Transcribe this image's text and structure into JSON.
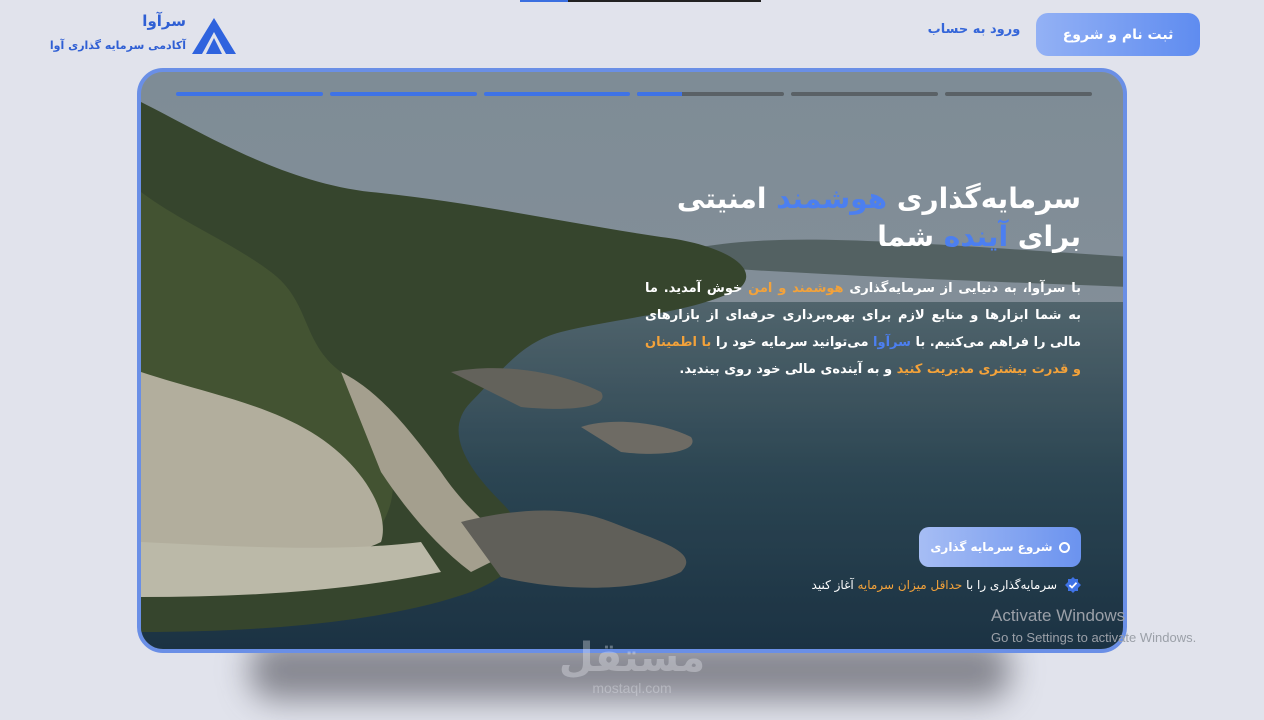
{
  "header": {
    "logo_name": "سرآوا",
    "logo_subtitle": "آکادمی سرمایه گذاری آوا",
    "login_label": "ورود به حساب",
    "signup_label": "ثبت نام و شروع"
  },
  "hero": {
    "slide_progress": [
      1,
      1,
      1,
      0.3,
      0,
      0
    ],
    "title_part1": "سرمایه‌گذاری ",
    "title_highlight1": "هوشمند",
    "title_part2": " امنیتی برای ",
    "title_highlight2": "آینده",
    "title_part3": " شما",
    "desc_part1": "با سرآوا، به دنیایی از سرمایه‌گذاری ",
    "desc_highlight1": "هوشمند و امن",
    "desc_part2": " خوش آمدید. ما به شما ابزارها و منابع لازم برای بهره‌برداری حرفه‌ای از بازارهای مالی را فراهم می‌کنیم. با ",
    "desc_highlight2": "سرآوا",
    "desc_part3": " می‌توانید سرمایه خود را ",
    "desc_highlight3": "با اطمینان",
    "desc_highlight4": " و قدرت بیشتری مدیریت کنید",
    "desc_part4": " و به آینده‌ی مالی خود روی بیندید.",
    "cta_label": "شروع سرمایه گذاری",
    "note_part1": "سرمایه‌گذاری را با ",
    "note_highlight": "حداقل میزان سرمایه",
    "note_part2": " آغاز کنید"
  },
  "overlay": {
    "activate_title": "Activate Windows",
    "activate_sub": "Go to Settings to activate Windows.",
    "mostaql_ar": "مستقل",
    "mostaql_en": "mostaql.com"
  },
  "colors": {
    "accent_blue": "#3f73e6",
    "accent_orange": "#f3a23a",
    "page_bg": "#e1e3ec"
  }
}
